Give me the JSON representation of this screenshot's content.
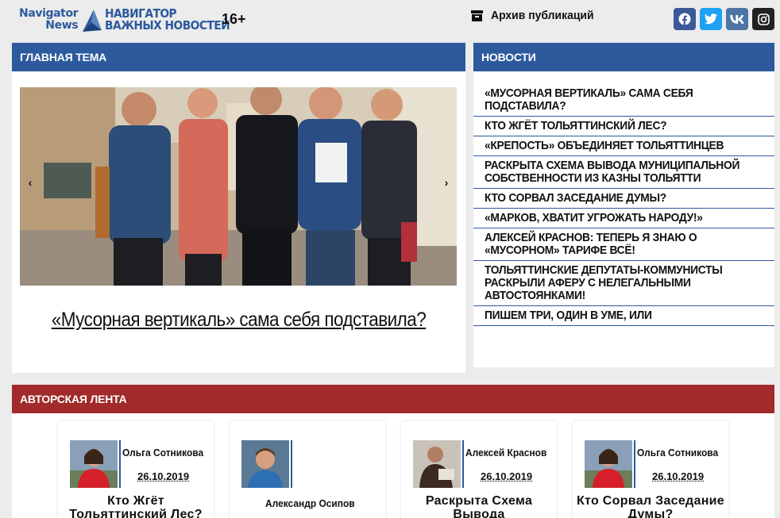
{
  "header": {
    "logo_en_line1": "Navigator",
    "logo_en_line2": "News",
    "logo_ru_line1": "НАВИГАТОР",
    "logo_ru_line2": "ВАЖНЫХ НОВОСТЕЙ",
    "age_rating": "16+",
    "archive_label": "Архив публикаций",
    "socials": [
      {
        "icon": "facebook-icon",
        "glyph": "f"
      },
      {
        "icon": "twitter-icon",
        "glyph": "t"
      },
      {
        "icon": "vk-icon",
        "glyph": "vk"
      },
      {
        "icon": "instagram-icon",
        "glyph": "ig"
      }
    ]
  },
  "colors": {
    "brand_blue": "#2c5a9c",
    "author_red": "#a12a2a",
    "background": "#ececec"
  },
  "main_topic": {
    "heading": "ГЛАВНАЯ ТЕМА",
    "prev_glyph": "‹",
    "next_glyph": "›",
    "title": "«Мусорная вертикаль» сама себя подставила?"
  },
  "news": {
    "heading": "НОВОСТИ",
    "items": [
      "«МУСОРНАЯ ВЕРТИКАЛЬ» САМА СЕБЯ ПОДСТАВИЛА?",
      "КТО ЖГЁТ ТОЛЬЯТТИНСКИЙ ЛЕС?",
      "«КРЕПОСТЬ» ОБЪЕДИНЯЕТ ТОЛЬЯТТИНЦЕВ",
      "РАСКРЫТА СХЕМА ВЫВОДА МУНИЦИПАЛЬНОЙ СОБСТВЕННОСТИ ИЗ КАЗНЫ ТОЛЬЯТТИ",
      "КТО СОРВАЛ ЗАСЕДАНИЕ ДУМЫ?",
      "«МАРКОВ, ХВАТИТ УГРОЖАТЬ НАРОДУ!»",
      "АЛЕКСЕЙ КРАСНОВ: ТЕПЕРЬ Я ЗНАЮ О «МУСОРНОМ» ТАРИФЕ ВСЁ!",
      "ТОЛЬЯТТИНСКИЕ ДЕПУТАТЫ-КОММУНИСТЫ РАСКРЫЛИ АФЕРУ С НЕЛЕГАЛЬНЫМИ АВТОСТОЯНКАМИ!",
      "ПИШЕМ ТРИ, ОДИН В УМЕ, ИЛИ"
    ]
  },
  "author_feed": {
    "heading": "АВТОРСКАЯ ЛЕНТА",
    "cards": [
      {
        "author": "Ольга Сотникова",
        "date": "26.10.2019",
        "title": "Кто Жгёт Тольяттинский Лес?"
      },
      {
        "author": "Александр Осипов",
        "date": "",
        "title": ""
      },
      {
        "author": "Алексей Краснов",
        "date": "26.10.2019",
        "title": "Раскрыта Схема Вывода"
      },
      {
        "author": "Ольга Сотникова",
        "date": "26.10.2019",
        "title": "Кто Сорвал Заседание Думы?"
      }
    ]
  }
}
